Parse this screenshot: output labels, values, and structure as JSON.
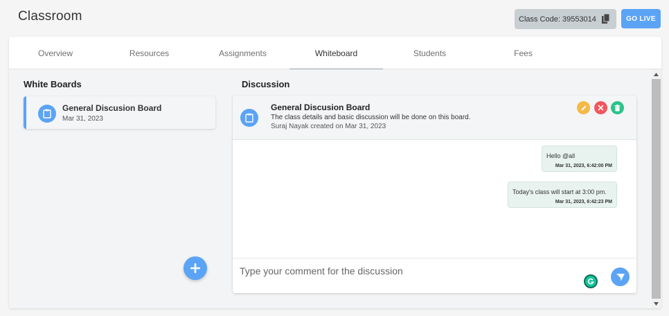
{
  "header": {
    "title": "Classroom",
    "class_code": "Class Code: 39553014",
    "go_live_label": "GO LIVE"
  },
  "tabs": [
    {
      "label": "Overview",
      "active": false
    },
    {
      "label": "Resources",
      "active": false
    },
    {
      "label": "Assignments",
      "active": false
    },
    {
      "label": "Whiteboard",
      "active": true
    },
    {
      "label": "Students",
      "active": false
    },
    {
      "label": "Fees",
      "active": false
    }
  ],
  "whiteboards": {
    "title": "White Boards",
    "items": [
      {
        "name": "General Discusion Board",
        "date": "Mar 31, 2023",
        "icon": "clipboard-icon"
      }
    ]
  },
  "discussion": {
    "title": "Discussion",
    "board_name": "General Discusion Board",
    "description": "The class details and basic discussion will be done on this board.",
    "meta": "Suraj Nayak created on Mar 31, 2023",
    "messages": [
      {
        "text": "Hello @all",
        "time": "Mar 31, 2023, 6:42:00 PM"
      },
      {
        "text": "Today's class will start at 3:00 pm.",
        "time": "Mar 31, 2023, 6:42:23 PM"
      }
    ],
    "comment_placeholder": "Type your comment for the discussion"
  },
  "colors": {
    "accent": "#5ba3f5",
    "edit": "#f5b947",
    "close": "#f0575c",
    "delete": "#2bc48a",
    "message_bg": "#e8f3ef"
  }
}
